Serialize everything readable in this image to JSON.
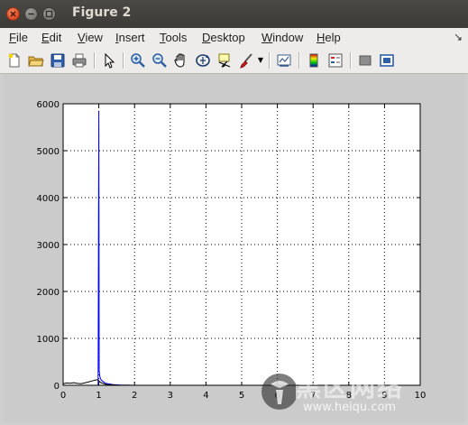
{
  "window": {
    "title": "Figure 2"
  },
  "menubar": {
    "items": [
      "File",
      "Edit",
      "View",
      "Insert",
      "Tools",
      "Desktop",
      "Window",
      "Help"
    ],
    "underline": [
      "F",
      "E",
      "V",
      "I",
      "T",
      "D",
      "W",
      "H"
    ],
    "dock_arrow": "↘"
  },
  "toolbar": {
    "icons": [
      "new-figure-icon",
      "open-file-icon",
      "save-icon",
      "print-icon",
      "edit-plot-icon",
      "zoom-in-icon",
      "zoom-out-icon",
      "pan-icon",
      "rotate-3d-icon",
      "data-cursor-icon",
      "brush-icon",
      "brush-dropdown-icon",
      "link-plot-icon",
      "colorbar-icon",
      "legend-icon",
      "hide-plot-tools-icon",
      "show-plot-tools-icon"
    ]
  },
  "watermark": {
    "text": "黑区网络",
    "url": "www.heiqu.com"
  },
  "chart_data": {
    "type": "line",
    "title": "",
    "xlabel": "",
    "ylabel": "",
    "xlim": [
      0,
      10
    ],
    "ylim": [
      0,
      6000
    ],
    "xticks": [
      0,
      1,
      2,
      3,
      4,
      5,
      6,
      7,
      8,
      9,
      10
    ],
    "yticks": [
      0,
      1000,
      2000,
      3000,
      4000,
      5000,
      6000
    ],
    "grid": true,
    "series": [
      {
        "color": "#0000ff",
        "x": [
          0,
          0.98,
          1.0,
          1.01,
          1.03,
          1.06,
          1.1,
          1.2,
          1.4,
          1.6,
          2.0,
          4.0,
          6.0,
          8.0,
          10.0
        ],
        "y": [
          0,
          0,
          5850,
          300,
          180,
          120,
          90,
          40,
          15,
          5,
          0,
          0,
          0,
          0,
          0
        ]
      },
      {
        "color": "#000000",
        "x": [
          0,
          0.1,
          0.2,
          0.3,
          0.4,
          0.5,
          0.6,
          0.7,
          0.8,
          0.9,
          0.97,
          1.05,
          1.2,
          1.5,
          2.0,
          10.0
        ],
        "y": [
          30,
          50,
          45,
          55,
          40,
          35,
          50,
          70,
          90,
          110,
          120,
          60,
          20,
          5,
          0,
          0
        ]
      }
    ]
  }
}
